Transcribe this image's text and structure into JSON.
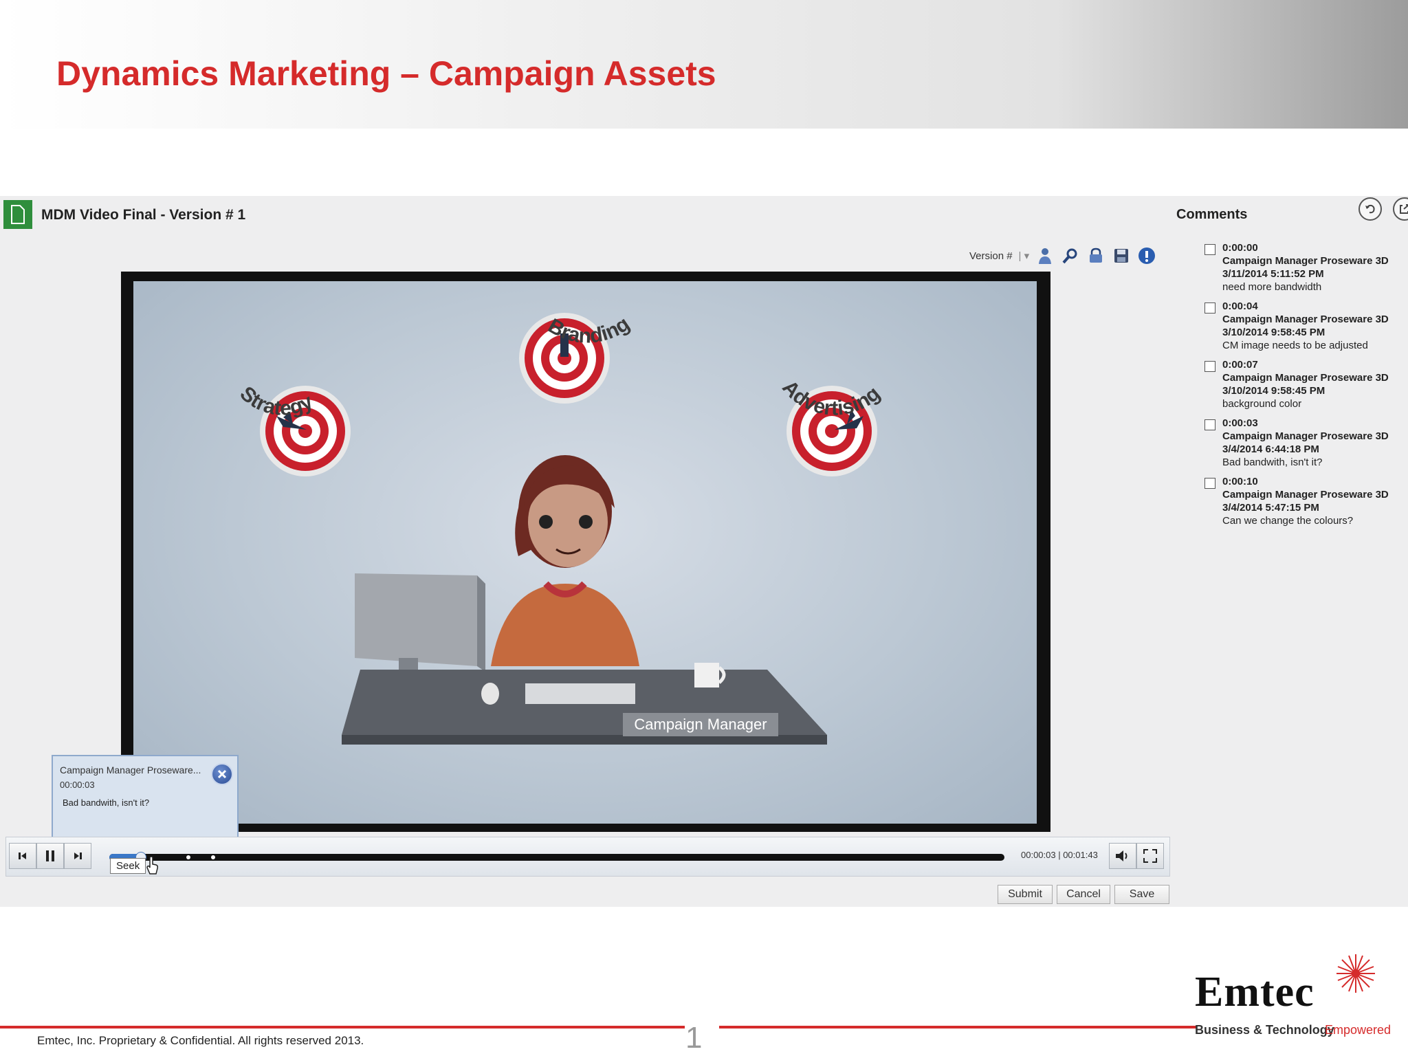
{
  "slide": {
    "title": "Dynamics Marketing – Campaign Assets",
    "footer": "Emtec, Inc. Proprietary & Confidential. All rights reserved 2013.",
    "page_number": "1",
    "logo_name": "Emtec",
    "logo_tagline": "Business & Technology",
    "logo_tagline_accent": "Empowered"
  },
  "app": {
    "title": "MDM Video Final - Version # 1",
    "version_label": "Version #",
    "toolbar_icons": [
      "user-icon",
      "search-icon",
      "lock-icon",
      "save-icon",
      "info-icon"
    ]
  },
  "video": {
    "scene_labels": {
      "strategy": "Strategy",
      "branding": "Branding",
      "advertising": "Advertising",
      "role": "Campaign Manager"
    },
    "time": "00:00:03 | 00:01:43",
    "progress": 0.035,
    "seek_tooltip": "Seek",
    "popup": {
      "author": "Campaign Manager Proseware...",
      "time": "00:00:03",
      "text": "Bad bandwith, isn't it?"
    }
  },
  "actions": {
    "submit": "Submit",
    "cancel": "Cancel",
    "save": "Save"
  },
  "comments": {
    "title": "Comments",
    "items": [
      {
        "time": "0:00:00",
        "author": "Campaign Manager Proseware 3D",
        "date": "3/11/2014 5:11:52 PM",
        "text": "need more bandwidth"
      },
      {
        "time": "0:00:04",
        "author": "Campaign Manager Proseware 3D",
        "date": "3/10/2014 9:58:45 PM",
        "text": "CM image needs to be adjusted"
      },
      {
        "time": "0:00:07",
        "author": "Campaign Manager Proseware 3D",
        "date": "3/10/2014 9:58:45 PM",
        "text": "background color"
      },
      {
        "time": "0:00:03",
        "author": "Campaign Manager Proseware 3D",
        "date": "3/4/2014 6:44:18 PM",
        "text": "Bad bandwith, isn't it?"
      },
      {
        "time": "0:00:10",
        "author": "Campaign Manager Proseware 3D",
        "date": "3/4/2014 5:47:15 PM",
        "text": "Can we change the colours?"
      }
    ]
  },
  "colors": {
    "title_red": "#d52b2b",
    "progress_blue": "#3a78c8",
    "doc_icon_green": "#2f8e3c"
  }
}
